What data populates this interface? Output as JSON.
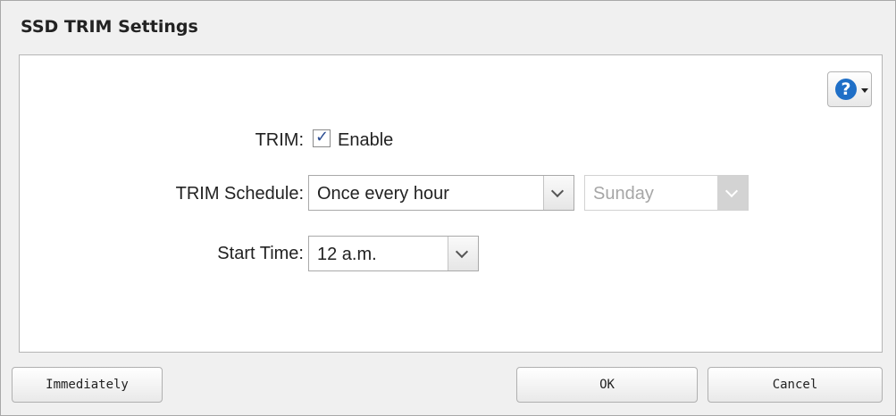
{
  "dialog": {
    "title": "SSD TRIM Settings"
  },
  "help": {
    "icon": "help-icon",
    "glyph": "?"
  },
  "form": {
    "trim_label": "TRIM:",
    "enable_label": "Enable",
    "enable_checked": true,
    "schedule_label": "TRIM Schedule:",
    "schedule_value": "Once every hour",
    "day_value": "Sunday",
    "day_disabled": true,
    "start_time_label": "Start Time:",
    "start_time_value": "12 a.m."
  },
  "footer": {
    "immediately_label": "Immediately",
    "ok_label": "OK",
    "cancel_label": "Cancel"
  }
}
